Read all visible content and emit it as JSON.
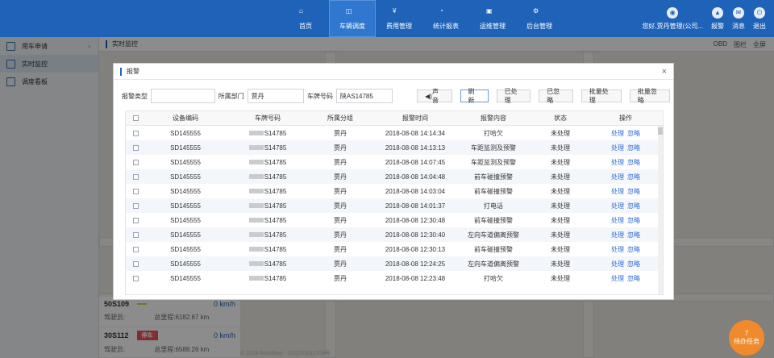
{
  "topbar": {
    "nav": [
      {
        "label": "首页",
        "icon": "home-icon"
      },
      {
        "label": "车辆调度",
        "icon": "layers-icon"
      },
      {
        "label": "费用管理",
        "icon": "money-icon"
      },
      {
        "label": "统计报表",
        "icon": "chart-icon"
      },
      {
        "label": "运维管理",
        "icon": "monitor-icon"
      },
      {
        "label": "后台管理",
        "icon": "gear-icon"
      }
    ],
    "user_label": "您好,贾丹管理(公司...",
    "alarm_label": "报警",
    "msg_label": "消息",
    "exit_label": "退出"
  },
  "sidebar": {
    "items": [
      {
        "label": "用车申请"
      },
      {
        "label": "实时监控"
      },
      {
        "label": "调度看板"
      }
    ]
  },
  "crumb": "实时监控",
  "map_opts": {
    "obd": "OBD",
    "layers": "图栏",
    "fullscreen": "全屏"
  },
  "vehicles": [
    {
      "plate": "50S109",
      "status": "",
      "speed": "0 km/h",
      "driver_label": "驾驶员:",
      "mileage_label": "总里程:",
      "mileage": "6182.67 km"
    },
    {
      "plate": "30S112",
      "status": "停车",
      "speed": "0 km/h",
      "driver_label": "驾驶员:",
      "mileage_label": "总里程:",
      "mileage": "6588.26 km"
    }
  ],
  "modal": {
    "title": "报警",
    "filters": {
      "type_label": "报警类型",
      "type_value": "",
      "dept_label": "所属部门",
      "dept_value": "贾丹",
      "plate_label": "车牌号码",
      "plate_value": "陕AS14785"
    },
    "buttons": [
      "声音",
      "刷新",
      "已处理",
      "已忽略",
      "批量处理",
      "批量忽略"
    ],
    "columns": [
      "设备编码",
      "车牌号码",
      "所属分组",
      "报警时间",
      "报警内容",
      "状态",
      "操作"
    ],
    "rows": [
      {
        "device": "SD145555",
        "plate": "S14785",
        "group": "贾丹",
        "time": "2018-08-08 14:14:34",
        "content": "打哈欠",
        "status": "未处理",
        "op1": "处理",
        "op2": "忽略"
      },
      {
        "device": "SD145555",
        "plate": "S14785",
        "group": "贾丹",
        "time": "2018-08-08 14:13:13",
        "content": "车距监测及预警",
        "status": "未处理",
        "op1": "处理",
        "op2": "忽略"
      },
      {
        "device": "SD145555",
        "plate": "S14785",
        "group": "贾丹",
        "time": "2018-08-08 14:07:45",
        "content": "车距监测及预警",
        "status": "未处理",
        "op1": "处理",
        "op2": "忽略"
      },
      {
        "device": "SD145555",
        "plate": "S14785",
        "group": "贾丹",
        "time": "2018-08-08 14:04:48",
        "content": "前车碰撞预警",
        "status": "未处理",
        "op1": "处理",
        "op2": "忽略"
      },
      {
        "device": "SD145555",
        "plate": "S14785",
        "group": "贾丹",
        "time": "2018-08-08 14:03:04",
        "content": "前车碰撞预警",
        "status": "未处理",
        "op1": "处理",
        "op2": "忽略"
      },
      {
        "device": "SD145555",
        "plate": "S14785",
        "group": "贾丹",
        "time": "2018-08-08 14:01:37",
        "content": "打电话",
        "status": "未处理",
        "op1": "处理",
        "op2": "忽略"
      },
      {
        "device": "SD145555",
        "plate": "S14785",
        "group": "贾丹",
        "time": "2018-08-08 12:30:48",
        "content": "前车碰撞预警",
        "status": "未处理",
        "op1": "处理",
        "op2": "忽略"
      },
      {
        "device": "SD145555",
        "plate": "S14785",
        "group": "贾丹",
        "time": "2018-08-08 12:30:40",
        "content": "左向车道偏离预警",
        "status": "未处理",
        "op1": "处理",
        "op2": "忽略"
      },
      {
        "device": "SD145555",
        "plate": "S14785",
        "group": "贾丹",
        "time": "2018-08-08 12:30:13",
        "content": "前车碰撞预警",
        "status": "未处理",
        "op1": "处理",
        "op2": "忽略"
      },
      {
        "device": "SD145555",
        "plate": "S14785",
        "group": "贾丹",
        "time": "2018-08-08 12:24:25",
        "content": "左向车道偏离预警",
        "status": "未处理",
        "op1": "处理",
        "op2": "忽略"
      },
      {
        "device": "SD145555",
        "plate": "S14785",
        "group": "贾丹",
        "time": "2018-08-08 12:23:48",
        "content": "打哈欠",
        "status": "未处理",
        "op1": "处理",
        "op2": "忽略"
      }
    ]
  },
  "badge": {
    "count": "7",
    "label": "待办任务"
  },
  "footer": "© 2018 AutoNavi - GS(2018)1709号"
}
